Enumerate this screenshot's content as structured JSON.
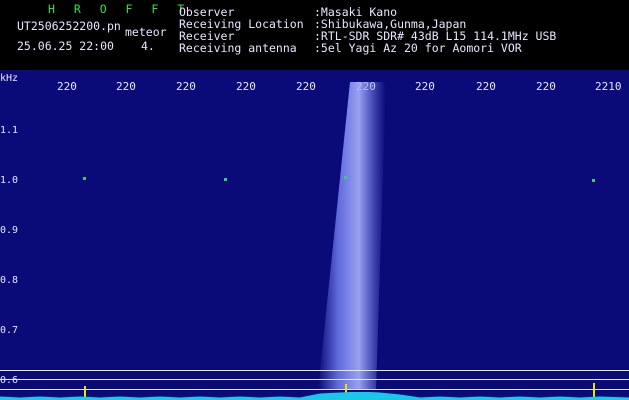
{
  "header": {
    "logo": "H R O F F T",
    "filename": "UT2506252200.pn",
    "meteor_label": "meteor",
    "timestamp": "25.06.25 22:00",
    "count": "4.",
    "fields": [
      {
        "label": "Observer",
        "value": ":Masaki Kano"
      },
      {
        "label": "Receiving Location",
        "value": ":Shibukawa,Gunma,Japan"
      },
      {
        "label": "Receiver",
        "value": ":RTL-SDR SDR# 43dB L15 114.1MHz USB"
      },
      {
        "label": "Receiving antenna",
        "value": ":5el Yagi Az 20 for Aomori VOR"
      }
    ]
  },
  "plot": {
    "y_unit": "kHz",
    "y_ticks": [
      "1.1",
      "1.0",
      "0.9",
      "0.8",
      "0.7",
      "0.6"
    ],
    "x_ticks": [
      "220",
      "220",
      "220",
      "220",
      "220",
      "220",
      "220",
      "220",
      "220",
      "2210"
    ],
    "background_color": "#0a0a78",
    "meteor_color": "#7f8cff"
  }
}
